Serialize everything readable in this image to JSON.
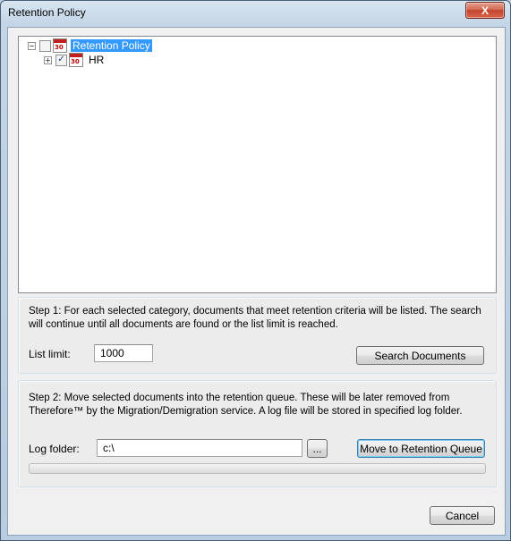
{
  "window": {
    "title": "Retention Policy",
    "close_glyph": "X"
  },
  "tree": {
    "nodes": [
      {
        "label": "Retention Policy",
        "expander": "−",
        "checked": false,
        "icon": "calendar-icon",
        "icon_text": "30",
        "selected": true
      },
      {
        "label": "HR",
        "expander": "+",
        "checked": true,
        "icon": "calendar-icon",
        "icon_text": "30",
        "selected": false
      }
    ]
  },
  "step1": {
    "description": "Step 1: For each selected category, documents that meet retention criteria will be listed. The search will continue until all documents are found or the list limit is reached.",
    "list_limit_label": "List limit:",
    "list_limit_value": "1000",
    "search_button": "Search Documents"
  },
  "step2": {
    "description": "Step 2: Move selected documents  into the retention queue. These will be later removed from Therefore™ by the Migration/Demigration service. A log file will be stored in specified log folder.",
    "log_folder_label": "Log folder:",
    "log_folder_value": "c:\\",
    "browse_button": "...",
    "move_button": "Move to Retention Queue",
    "progress": 0
  },
  "footer": {
    "cancel_button": "Cancel"
  },
  "colors": {
    "selection": "#3399ff",
    "close_button": "#c2432d",
    "window_frame": "#b9cde0"
  }
}
